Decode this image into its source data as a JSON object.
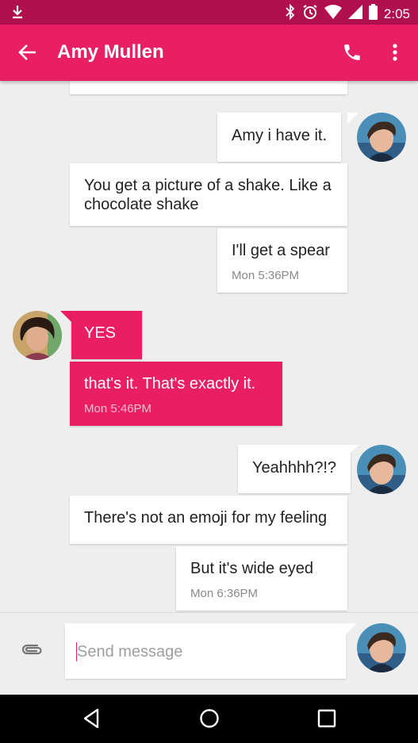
{
  "status_bar": {
    "time": "2:05"
  },
  "header": {
    "title": "Amy Mullen"
  },
  "messages": [
    {
      "direction": "out",
      "text": "Amy i have it."
    },
    {
      "direction": "out",
      "text": "You get a picture of a shake. Like a chocolate shake"
    },
    {
      "direction": "out",
      "text": "I'll get a spear",
      "timestamp": "Mon 5:36PM"
    },
    {
      "direction": "in",
      "text": "YES"
    },
    {
      "direction": "in",
      "text": "that's it. That's exactly it.",
      "timestamp": "Mon 5:46PM"
    },
    {
      "direction": "out",
      "text": "Yeahhhh?!?"
    },
    {
      "direction": "out",
      "text": "There's not an emoji for my feeling"
    },
    {
      "direction": "out",
      "text": "But it's wide eyed",
      "timestamp": "Mon 6:36PM"
    }
  ],
  "compose": {
    "placeholder": "Send message"
  },
  "colors": {
    "accent": "#e91e63",
    "status_bar": "#b0104e",
    "background": "#eeeeee"
  },
  "icons": {
    "status": [
      "download-icon",
      "bluetooth-icon",
      "alarm-icon",
      "wifi-icon",
      "signal-icon",
      "battery-icon"
    ],
    "header": [
      "back-arrow-icon",
      "phone-icon",
      "more-vert-icon"
    ],
    "compose": [
      "attach-icon"
    ],
    "nav": [
      "back-triangle-icon",
      "home-circle-icon",
      "recents-square-icon"
    ]
  }
}
